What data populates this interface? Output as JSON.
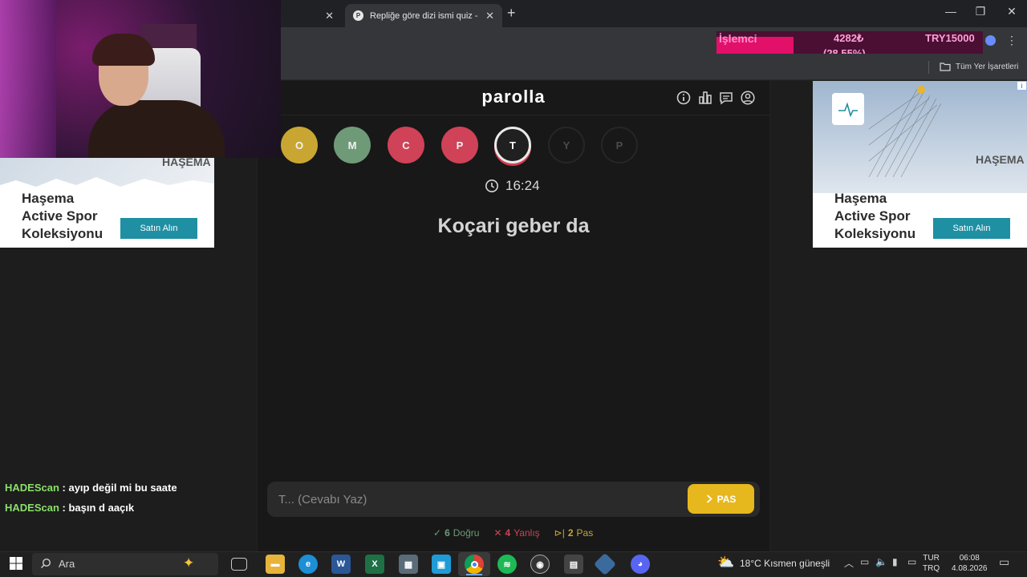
{
  "browser": {
    "tabs": [
      {
        "title": "",
        "active": false
      },
      {
        "title": "Repliğe göre dizi ismi quiz - parolla",
        "active": true,
        "favicon_letter": "P"
      }
    ],
    "bookmarks_folder": "Tüm Yer İşaretleri"
  },
  "overlay": {
    "cpu_label": "İşlemci",
    "cpu_value": "4282₺",
    "cpu_percent": "(28.55%)",
    "cpu_fill_fraction": 0.29,
    "try_label": "TRY15000"
  },
  "game": {
    "logo": "parolla",
    "header_icons": [
      "info-icon",
      "stats-icon",
      "feedback-icon",
      "profile-icon"
    ],
    "letters": [
      {
        "letter": "O",
        "state": "done",
        "color": "#c9a632"
      },
      {
        "letter": "M",
        "state": "correct",
        "color": "#6f9a78"
      },
      {
        "letter": "C",
        "state": "wrong",
        "color": "#cf4257"
      },
      {
        "letter": "P",
        "state": "wrong",
        "color": "#cf4257"
      },
      {
        "letter": "T",
        "state": "current",
        "color": "#202020"
      },
      {
        "letter": "Y",
        "state": "future",
        "color": "#181818"
      },
      {
        "letter": "P",
        "state": "future",
        "color": "#181818"
      }
    ],
    "timer": "16:24",
    "question": "Koçari geber da",
    "answer_placeholder": "T... (Cevabı Yaz)",
    "pas_label": "PAS",
    "stats": {
      "correct_count": "6",
      "correct_label": "Doğru",
      "correct_color": "#6f9a78",
      "wrong_count": "4",
      "wrong_label": "Yanlış",
      "wrong_color": "#cf4257",
      "pass_count": "2",
      "pass_label": "Pas",
      "pass_color": "#c9a632"
    }
  },
  "ads": {
    "left": {
      "brand": "HAŞEMA",
      "line1": "Haşema",
      "line2": "Active Spor",
      "line3": "Koleksiyonu",
      "cta": "Satın Alın"
    },
    "right": {
      "brand": "HAŞEMA",
      "line1": "Haşema",
      "line2": "Active Spor",
      "line3": "Koleksiyonu",
      "cta": "Satın Alın"
    }
  },
  "chat": [
    {
      "user": "HADEScan",
      "message": " : ayıp değil mi bu saate"
    },
    {
      "user": "HADEScan",
      "message": " : başın d aaçık"
    }
  ],
  "taskbar": {
    "search_placeholder": "Ara",
    "weather": "18°C  Kısmen güneşli",
    "lang_top": "TUR",
    "lang_bottom": "TRQ",
    "time": "06:08",
    "date": "4.08.2026"
  }
}
